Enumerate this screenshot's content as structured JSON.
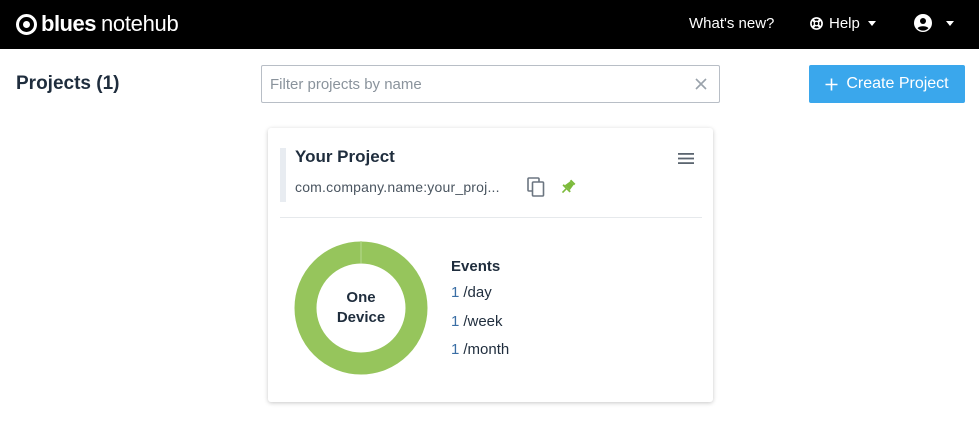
{
  "brand": {
    "word1": "blues",
    "word2": "notehub"
  },
  "nav": {
    "whats_new": "What's new?",
    "help": "Help"
  },
  "page": {
    "title": "Projects (1)",
    "filter_placeholder": "Filter projects by name",
    "filter_value": "",
    "create_label": "Create Project"
  },
  "project": {
    "name": "Your Project",
    "uid": "com.company.name:your_proj...",
    "device_label_line1": "One",
    "device_label_line2": "Device",
    "device_count": 1,
    "events_title": "Events",
    "events": [
      {
        "count": "1",
        "unit": "/day"
      },
      {
        "count": "1",
        "unit": "/week"
      },
      {
        "count": "1",
        "unit": "/month"
      }
    ]
  },
  "colors": {
    "topbar": "#000000",
    "accent_button": "#3aa7ec",
    "donut": "#96c55c",
    "pin": "#7cba3b",
    "event_count": "#3a6ea5"
  },
  "icons": {
    "brand": "blues-logo-icon",
    "help": "help-lifebuoy-icon",
    "account": "account-circle-icon",
    "clear": "close-icon",
    "create": "plus-icon",
    "copy": "copy-icon",
    "pin": "pin-icon",
    "menu": "hamburger-menu-icon"
  }
}
